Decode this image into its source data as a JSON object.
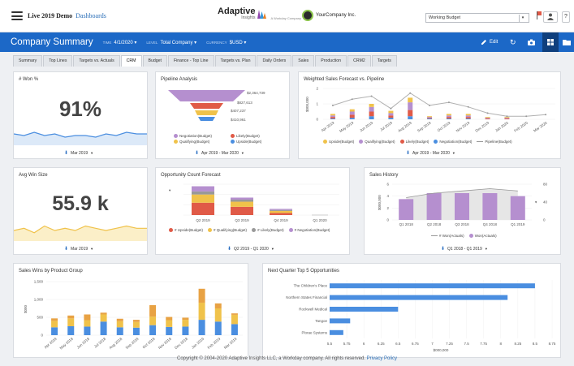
{
  "app": {
    "title": "Live 2019 Demo",
    "link": "Dashboards"
  },
  "brand": {
    "name": "Adaptive",
    "sub": "Insights",
    "wd": "A Workday Company"
  },
  "company_logo": {
    "name": "YourCompany Inc."
  },
  "budget_select": {
    "value": "Working Budget"
  },
  "header": {
    "title": "Company Summary",
    "filters": [
      {
        "label": "TIME",
        "value": "4/1/2020 ▾"
      },
      {
        "label": "LEVEL",
        "value": "Total Company ▾"
      },
      {
        "label": "CURRENCY",
        "value": "$USD ▾"
      }
    ],
    "edit": "Edit"
  },
  "tabs": [
    "Summary",
    "Top Lines",
    "Targets vs. Actuals",
    "CRM",
    "Budget",
    "Finance - Top Line",
    "Targets vs. Plan",
    "Daily Orders",
    "Sales",
    "Production",
    "CRM2",
    "Targets"
  ],
  "active_tab": "CRM",
  "panels": {
    "won": {
      "title": "# Won %",
      "value": "91%",
      "filter": "Mar 2019"
    },
    "pipeline": {
      "title": "Pipeline Analysis",
      "filter": "Apr 2019 - Mar 2020"
    },
    "weighted": {
      "title": "Weighted Sales Forecast vs. Pipeline",
      "filter": "Apr 2019 - Mar 2020"
    },
    "winsize": {
      "title": "Avg Win Size",
      "value": "55.9 k",
      "filter": "Mar 2019"
    },
    "oppcount": {
      "title": "Opportunity Count Forecast",
      "filter": "Q2 2019 - Q1 2020"
    },
    "history": {
      "title": "Sales History",
      "filter": "Q1 2018 - Q1 2019"
    },
    "winsgroup": {
      "title": "Sales Wins by Product Group"
    },
    "top5": {
      "title": "Next Quarter Top 5 Opportunities"
    }
  },
  "colors": {
    "header": "#1c68c7",
    "purple": "#b58fcf",
    "red": "#e05a47",
    "yellow": "#f0c24a",
    "blue": "#4a8ee0",
    "gray": "#bdbdbd",
    "grid_btn": "#0f3f7d"
  },
  "footer": {
    "text": "Copyright © 2004-2020 Adaptive Insights LLC, a Workday company. All rights reserved.",
    "link": "Privacy Policy"
  },
  "chart_data": [
    {
      "type": "line",
      "panel": "won",
      "x": [
        1,
        2,
        3,
        4,
        5,
        6,
        7,
        8,
        9,
        10,
        11,
        12,
        13,
        14
      ],
      "values": [
        6,
        5,
        7,
        5,
        6,
        4,
        5,
        5,
        4,
        6,
        5,
        7,
        6,
        6
      ]
    },
    {
      "type": "funnel",
      "panel": "pipeline",
      "values": [
        "$2,364,739",
        "$827,613",
        "$407,237",
        "$410,961"
      ],
      "legend": [
        "Negotiation(Budget)",
        "Likely(Budget)",
        "Qualifying(Budget)",
        "Upside(Budget)"
      ]
    },
    {
      "type": "bar",
      "panel": "weighted",
      "categories": [
        "Apr 2019",
        "May 2019",
        "Jun 2019",
        "Jul 2019",
        "Aug 2019",
        "Sep 2019",
        "Oct 2019",
        "Nov 2019",
        "Dec 2019",
        "Jan 2020",
        "Feb 2020",
        "Mar 2020"
      ],
      "ylabel": "$000,000",
      "yticks": [
        "0",
        "1",
        "2"
      ],
      "legend": [
        "Upside(Budget)",
        "Qualifying(Budget)",
        "Likely(Budget)",
        "Negotiation(Budget)",
        "Pipeline(Budget)"
      ],
      "series": [
        {
          "name": "Upside(Budget)",
          "values": [
            0.1,
            0.15,
            0.2,
            0.15,
            0.3,
            0.05,
            0.1,
            0.1,
            0.05,
            0.05,
            0,
            0
          ]
        },
        {
          "name": "Qualifying(Budget)",
          "values": [
            0.1,
            0.2,
            0.3,
            0.15,
            0.5,
            0.05,
            0.1,
            0.1,
            0.05,
            0.05,
            0,
            0
          ]
        },
        {
          "name": "Likely(Budget)",
          "values": [
            0.1,
            0.2,
            0.3,
            0.15,
            0.4,
            0.05,
            0.1,
            0.1,
            0.05,
            0.05,
            0,
            0
          ]
        },
        {
          "name": "Negotiation(Budget)",
          "values": [
            0.05,
            0.1,
            0.2,
            0.1,
            0.2,
            0.05,
            0.05,
            0.05,
            0,
            0,
            0,
            0
          ]
        },
        {
          "name": "Pipeline(Budget)",
          "values": [
            0.9,
            1.3,
            1.5,
            0.7,
            1.7,
            0.9,
            1.1,
            0.8,
            0.4,
            0.2,
            0.2,
            0.3
          ]
        }
      ]
    },
    {
      "type": "line",
      "panel": "winsize",
      "x": [
        1,
        2,
        3,
        4,
        5,
        6,
        7,
        8,
        9,
        10,
        11,
        12,
        13,
        14
      ],
      "values": [
        4,
        5,
        3,
        6,
        4,
        5,
        4,
        6,
        5,
        4,
        5,
        6,
        5,
        5
      ]
    },
    {
      "type": "bar",
      "panel": "oppcount",
      "categories": [
        "Q2 2019",
        "Q3 2019",
        "Q4 2019",
        "Q1 2020"
      ],
      "ylabel": "",
      "legend": [
        "# Upside(Budget)",
        "# Qualifying(Budget)",
        "# Likely(Budget)",
        "# Negotiation(Budget)"
      ],
      "series": [
        {
          "name": "# Upside(Budget)",
          "values": [
            12,
            8,
            2,
            0
          ]
        },
        {
          "name": "# Qualifying(Budget)",
          "values": [
            8,
            5,
            2,
            0
          ]
        },
        {
          "name": "# Likely(Budget)",
          "values": [
            3,
            2,
            1,
            0
          ]
        },
        {
          "name": "# Negotiation(Budget)",
          "values": [
            5,
            2,
            1,
            0
          ]
        }
      ]
    },
    {
      "type": "bar",
      "panel": "history",
      "categories": [
        "Q1 2018",
        "Q2 2018",
        "Q3 2018",
        "Q4 2018",
        "Q1 2019"
      ],
      "ylabel": "$000,000",
      "yticks": [
        "0",
        "2",
        "4",
        "6"
      ],
      "y2ticks": [
        "0",
        "40",
        "80"
      ],
      "legend": [
        "# Won(Actuals)",
        "Won(Actuals)"
      ],
      "series": [
        {
          "name": "Won(Actuals)",
          "values": [
            3.5,
            4.5,
            4.5,
            4.5,
            4.0
          ]
        },
        {
          "name": "# Won(Actuals)",
          "values": [
            50,
            60,
            65,
            70,
            65
          ]
        }
      ]
    },
    {
      "type": "bar",
      "panel": "winsgroup",
      "categories": [
        "Apr 2018",
        "May 2018",
        "Jun 2018",
        "Jul 2018",
        "Aug 2018",
        "Sep 2018",
        "Oct 2018",
        "Nov 2018",
        "Dec 2018",
        "Jan 2019",
        "Feb 2019",
        "Mar 2019"
      ],
      "ylabel": "$000",
      "yticks": [
        "0",
        "500",
        "1,000",
        "1,500"
      ],
      "series": [
        {
          "name": "blue",
          "values": [
            220,
            250,
            240,
            380,
            220,
            210,
            280,
            230,
            240,
            430,
            380,
            310
          ]
        },
        {
          "name": "yellow",
          "values": [
            180,
            220,
            180,
            200,
            170,
            160,
            240,
            190,
            190,
            480,
            370,
            260
          ]
        },
        {
          "name": "orange",
          "values": [
            70,
            80,
            160,
            50,
            70,
            60,
            320,
            90,
            60,
            390,
            140,
            40
          ]
        }
      ]
    },
    {
      "type": "bar",
      "panel": "top5",
      "orientation": "horizontal",
      "categories": [
        "The Children's Place",
        "Northern States Financial",
        "Rockwell Medical",
        "Tangoe",
        "Plorae Systems"
      ],
      "values": [
        8.5,
        8.1,
        6.5,
        5.8,
        5.7
      ],
      "xticks": [
        "5.5",
        "5.75",
        "6",
        "6.25",
        "6.5",
        "6.75",
        "7",
        "7.25",
        "7.5",
        "7.75",
        "8",
        "8.25",
        "8.5",
        "8.75"
      ],
      "xlabel": "$000,000",
      "xlim": [
        5.5,
        8.75
      ]
    }
  ]
}
